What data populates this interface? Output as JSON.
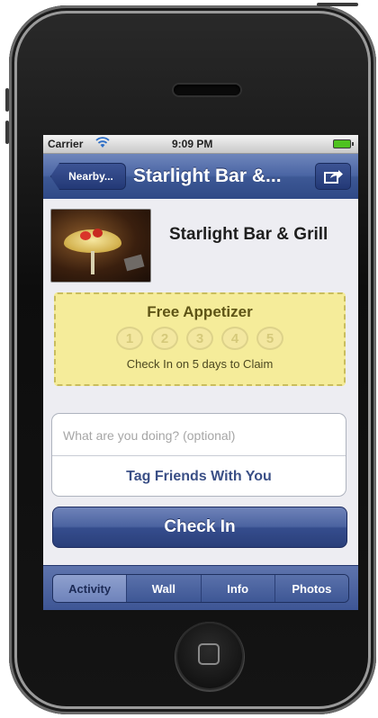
{
  "status_bar": {
    "carrier": "Carrier",
    "time": "9:09 PM"
  },
  "nav": {
    "back_label": "Nearby...",
    "title": "Starlight Bar &..."
  },
  "venue": {
    "name": "Starlight Bar & Grill"
  },
  "promo": {
    "title": "Free Appetizer",
    "steps": [
      "1",
      "2",
      "3",
      "4",
      "5"
    ],
    "caption": "Check In on 5 days to Claim"
  },
  "checkin_form": {
    "status_placeholder": "What are you doing? (optional)",
    "tag_friends_label": "Tag Friends With You",
    "checkin_label": "Check In"
  },
  "tabs": [
    {
      "label": "Activity",
      "active": true
    },
    {
      "label": "Wall",
      "active": false
    },
    {
      "label": "Info",
      "active": false
    },
    {
      "label": "Photos",
      "active": false
    }
  ]
}
